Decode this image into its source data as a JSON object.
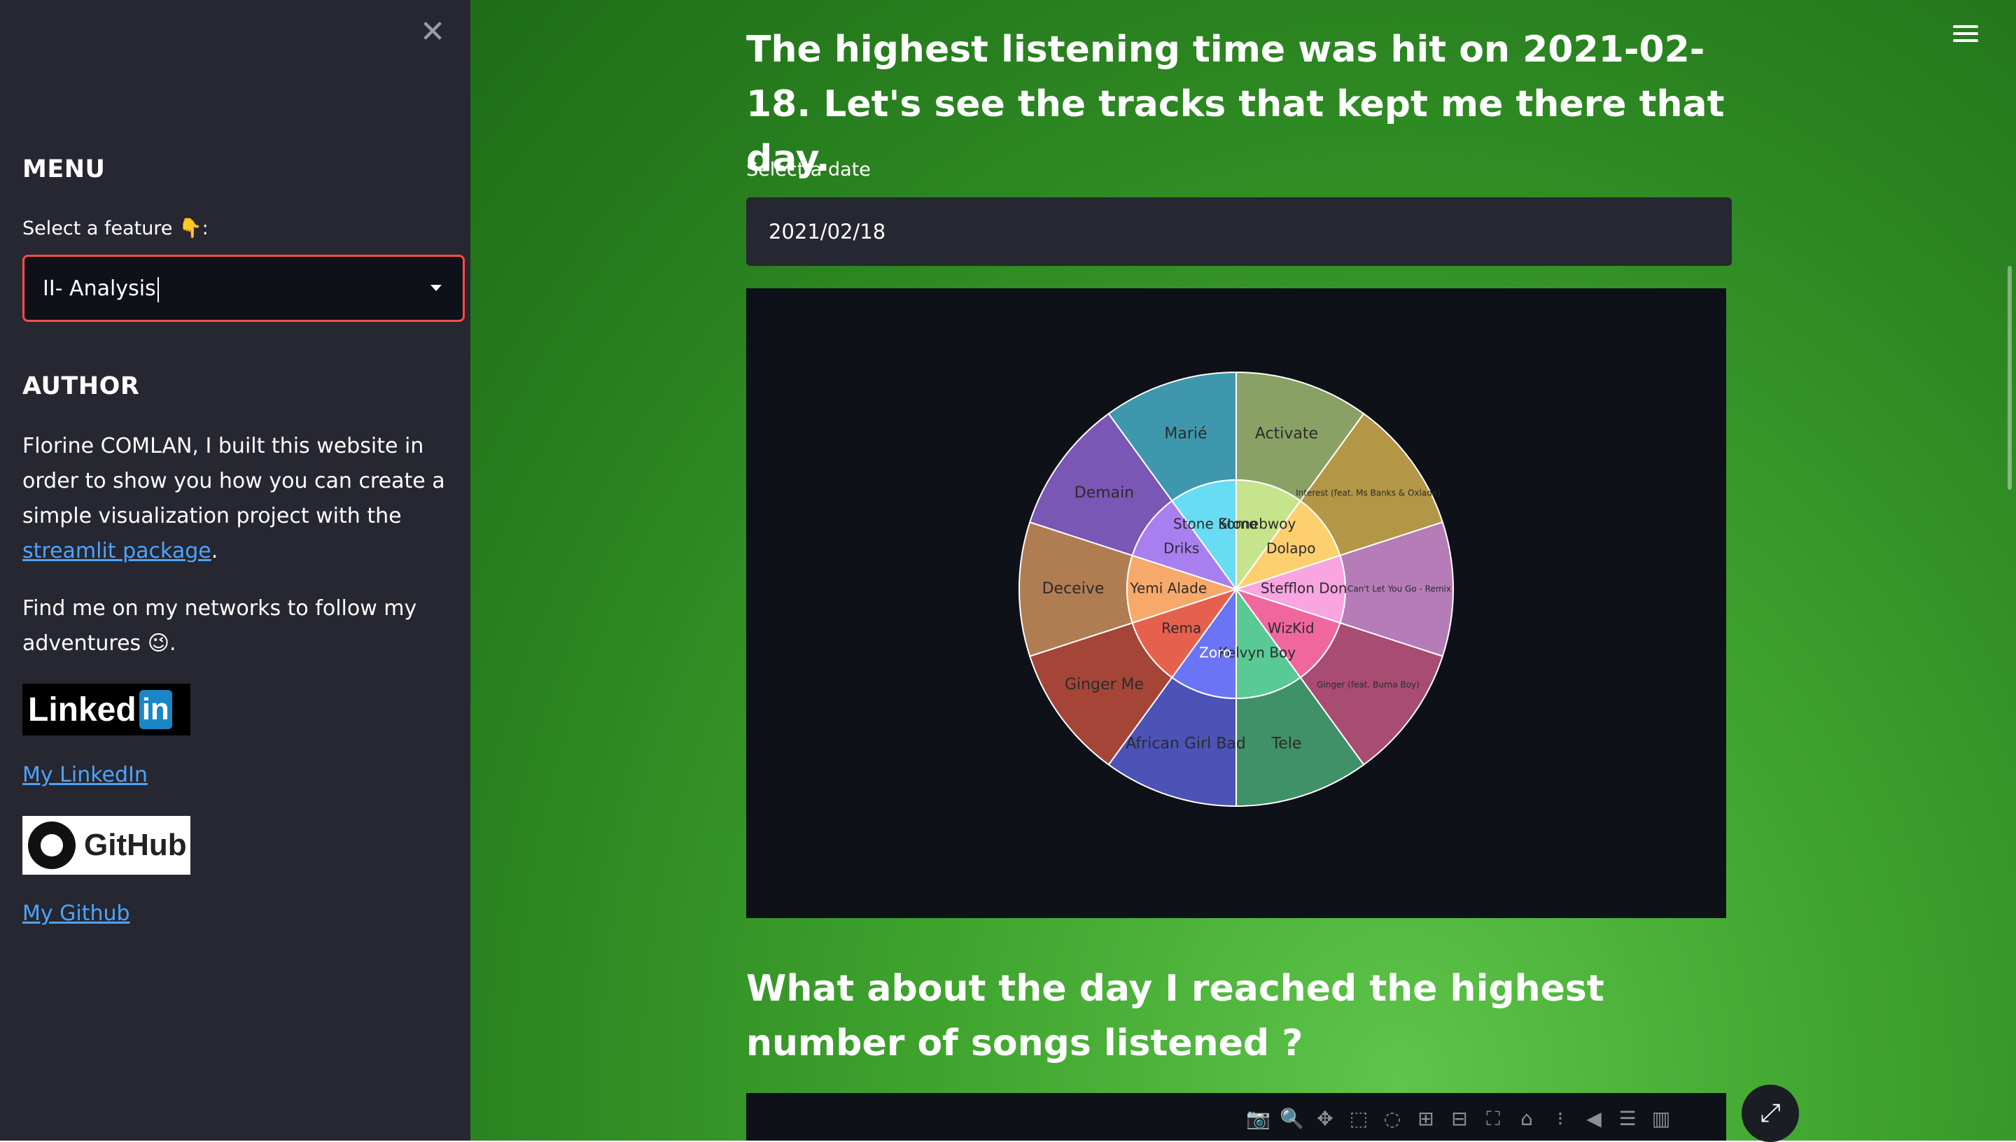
{
  "sidebar": {
    "close_icon": "✕",
    "menu_title": "MENU",
    "select_label": "Select a feature 👇:",
    "select_value": "II- Analysis",
    "author_title": "AUTHOR",
    "author_text_1": "Florine COMLAN, I built this website in order to show you how you can create a simple visualization project with the ",
    "author_link": "streamlit package",
    "author_text_2": ".",
    "networks_text": "Find me on my networks to follow my adventures 😉.",
    "linkedin_badge": "Linked",
    "linkedin_in": "in",
    "linkedin_link": "My LinkedIn",
    "github_badge": "GitHub",
    "github_link": "My Github"
  },
  "main": {
    "heading_1": "The highest listening time was hit on 2021-02-18. Let's see the tracks that kept me there that day.",
    "date_label": "Select a date",
    "date_value": "2021/02/18",
    "heading_2": "What about the day I reached the highest number of songs listened ?"
  },
  "chart_data": {
    "type": "sunburst",
    "inner": [
      {
        "artist": "Stonebwoy",
        "color": "#c6e48b"
      },
      {
        "artist": "Dolapo",
        "color": "#fdcf6e"
      },
      {
        "artist": "Stefflon Don",
        "color": "#f8a5e0"
      },
      {
        "artist": "WizKid",
        "color": "#f0679e"
      },
      {
        "artist": "Kelvyn Boy",
        "color": "#59c995"
      },
      {
        "artist": "Zoro",
        "color": "#6b74f5"
      },
      {
        "artist": "Rema",
        "color": "#e6604e"
      },
      {
        "artist": "Yemi Alade",
        "color": "#f6a96b"
      },
      {
        "artist": "Driks",
        "color": "#a97ff0"
      },
      {
        "artist": "Stone Komo",
        "color": "#67dcf3"
      }
    ],
    "outer": [
      {
        "track": "Activate",
        "artist": "Stonebwoy",
        "color": "#8aa165"
      },
      {
        "track": "Interest (feat. Ms Banks & Oxlade)",
        "artist": "Dolapo",
        "color": "#b39646"
      },
      {
        "track": "Can't Let You Go - Remix",
        "artist": "Stefflon Don",
        "color": "#b57cb8"
      },
      {
        "track": "Ginger (feat. Burna Boy)",
        "artist": "WizKid",
        "color": "#a84c72"
      },
      {
        "track": "Tele",
        "artist": "Kelvyn Boy",
        "color": "#3f9168"
      },
      {
        "track": "African Girl Bad",
        "artist": "Zoro",
        "color": "#4b53b7"
      },
      {
        "track": "Ginger Me",
        "artist": "Rema",
        "color": "#a44538"
      },
      {
        "track": "Deceive",
        "artist": "Yemi Alade",
        "color": "#b07d52"
      },
      {
        "track": "Demain",
        "artist": "Driks",
        "color": "#7a56b5"
      },
      {
        "track": "Marié",
        "artist": "Stone Komo",
        "color": "#3f97ad"
      }
    ]
  },
  "toolbar": [
    "camera-icon",
    "zoom-icon",
    "pan-icon",
    "box-select-icon",
    "lasso-icon",
    "zoom-in-icon",
    "zoom-out-icon",
    "autoscale-icon",
    "reset-icon",
    "spike-icon",
    "hover-closest-icon",
    "hover-compare-icon",
    "plotly-logo-icon"
  ]
}
